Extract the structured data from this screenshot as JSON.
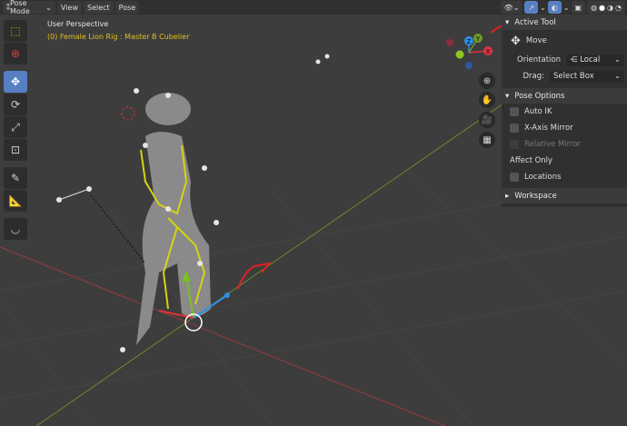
{
  "header": {
    "mode": "Pose Mode",
    "menus": [
      "View",
      "Select",
      "Pose"
    ]
  },
  "viewport": {
    "perspective": "User Perspective",
    "object_info": "(0) Female Lion Rig : Master B Cubelier"
  },
  "gizmo": {
    "z": "Z",
    "y": "Y",
    "x": "X"
  },
  "npanel": {
    "active_tool": {
      "title": "Active Tool",
      "tool": "Move",
      "orientation_label": "Orientation",
      "orientation_value": "Local",
      "drag_label": "Drag:",
      "drag_value": "Select Box"
    },
    "pose_options": {
      "title": "Pose Options",
      "auto_ik": "Auto IK",
      "x_mirror": "X-Axis Mirror",
      "relative_mirror": "Relative Mirror",
      "affect_only": "Affect Only",
      "locations": "Locations"
    },
    "workspace": {
      "title": "Workspace"
    }
  },
  "colors": {
    "accent": "#5680c2",
    "x_axis": "#c0393b",
    "y_axis": "#6f9a2b",
    "z_axis": "#2f8ee6",
    "annotation": "#e02020"
  }
}
